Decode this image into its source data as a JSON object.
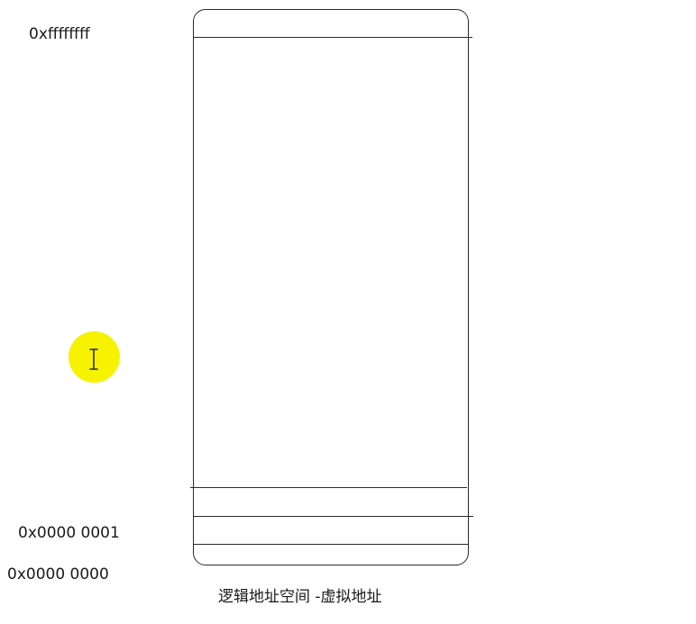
{
  "addresses": {
    "top": "0xffffffff",
    "one": "0x0000 0001",
    "zero": "0x0000 0000"
  },
  "caption": "逻辑地址空间 -虚拟地址",
  "cursor": {
    "icon": "text-cursor-icon",
    "highlight_color": "#f7f200"
  }
}
